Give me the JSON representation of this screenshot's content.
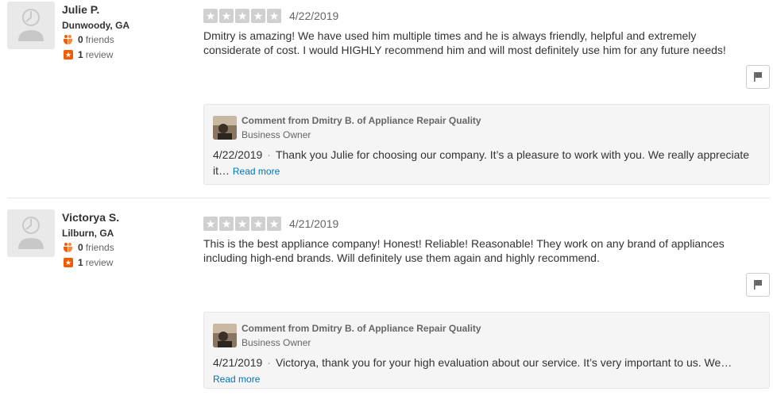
{
  "reviews": [
    {
      "user": {
        "name": "Julie P.",
        "location": "Dunwoody, GA",
        "friends_count": "0",
        "friends_label": "friends",
        "reviews_count": "1",
        "reviews_label": "review"
      },
      "rating": 5,
      "date": "4/22/2019",
      "text": "Dmitry is amazing!  We have used him multiple times and he is always friendly, helpful and extremely considerate of cost.  I would HIGHLY recommend him and will most definitely use him for any future needs!",
      "owner_comment": {
        "title": "Comment from Dmitry B. of Appliance Repair Quality",
        "role": "Business Owner",
        "date": "4/22/2019",
        "separator": "·",
        "text": "Thank you Julie for choosing our company. It’s a pleasure to work with you. We really appreciate it…",
        "read_more": "Read more"
      }
    },
    {
      "user": {
        "name": "Victorya S.",
        "location": "Lilburn, GA",
        "friends_count": "0",
        "friends_label": "friends",
        "reviews_count": "1",
        "reviews_label": "review"
      },
      "rating": 5,
      "date": "4/21/2019",
      "text": "This is the best appliance company! Honest! Reliable! Reasonable! They work on any brand of appliances including high-end brands. Will definitely use them again and highly recommend.",
      "owner_comment": {
        "title": "Comment from Dmitry B. of Appliance Repair Quality",
        "role": "Business Owner",
        "date": "4/21/2019",
        "separator": "·",
        "text": "Victorya, thank you for your high evaluation about our service. It’s very important to us. We…",
        "read_more": "Read more"
      }
    }
  ],
  "colors": {
    "star_empty": "#d0d0d0",
    "brand_orange": "#f15c00",
    "link": "#0073bb"
  },
  "icons": {
    "avatar": "default-user-icon",
    "friends": "friends-icon",
    "review": "review-star-icon",
    "flag": "flag-icon",
    "star": "star-icon"
  }
}
